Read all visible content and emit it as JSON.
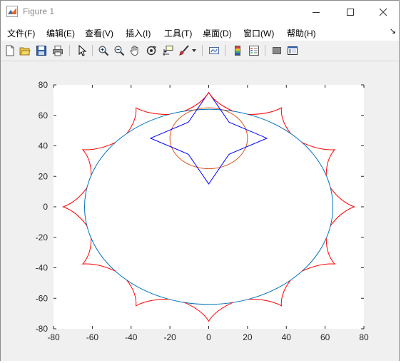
{
  "window": {
    "title": "Figure 1"
  },
  "menu": [
    {
      "label": "文件(F)",
      "name": "menu-file"
    },
    {
      "label": "编辑(E)",
      "name": "menu-edit"
    },
    {
      "label": "查看(V)",
      "name": "menu-view"
    },
    {
      "label": "插入(I)",
      "name": "menu-insert"
    },
    {
      "label": "工具(T)",
      "name": "menu-tools"
    },
    {
      "label": "桌面(D)",
      "name": "menu-desktop"
    },
    {
      "label": "窗口(W)",
      "name": "menu-window"
    },
    {
      "label": "帮助(H)",
      "name": "menu-help"
    }
  ],
  "toolbar": {
    "icons": [
      "new-figure-icon",
      "open-file-icon",
      "save-icon",
      "print-icon",
      "pointer-icon",
      "zoom-in-icon",
      "zoom-out-icon",
      "pan-icon",
      "rotate-3d-icon",
      "data-cursor-icon",
      "brush-icon",
      "link-plot-icon",
      "colorbar-icon",
      "legend-icon",
      "hide-plot-tools-icon",
      "show-plot-tools-icon"
    ]
  },
  "colors": {
    "circle": "#0072bd",
    "small_circle": "#d95319",
    "blue_star": "#0000ff",
    "red_star": "#ff0000"
  },
  "chart_data": {
    "type": "line",
    "title": "",
    "xlabel": "",
    "ylabel": "",
    "xlim": [
      -80,
      80
    ],
    "ylim": [
      -80,
      80
    ],
    "xticks": [
      -80,
      -60,
      -40,
      -20,
      0,
      20,
      40,
      60,
      80
    ],
    "yticks": [
      -80,
      -60,
      -40,
      -20,
      0,
      20,
      40,
      60,
      80
    ],
    "grid": false,
    "series": [
      {
        "shape": "circle",
        "center": [
          0,
          0
        ],
        "radius": 64,
        "color": "#0072bd"
      },
      {
        "shape": "circle",
        "center": [
          0,
          45
        ],
        "radius": 20,
        "color": "#d95319"
      },
      {
        "shape": "four-point-star",
        "center": [
          0,
          45
        ],
        "tips": [
          [
            0,
            75
          ],
          [
            30,
            45
          ],
          [
            0,
            15
          ],
          [
            -30,
            45
          ]
        ],
        "color": "#0000ff"
      },
      {
        "shape": "cusp-ring",
        "count": 12,
        "tip_radius": 75,
        "inner_radius": 64,
        "color": "#ff0000"
      }
    ]
  }
}
